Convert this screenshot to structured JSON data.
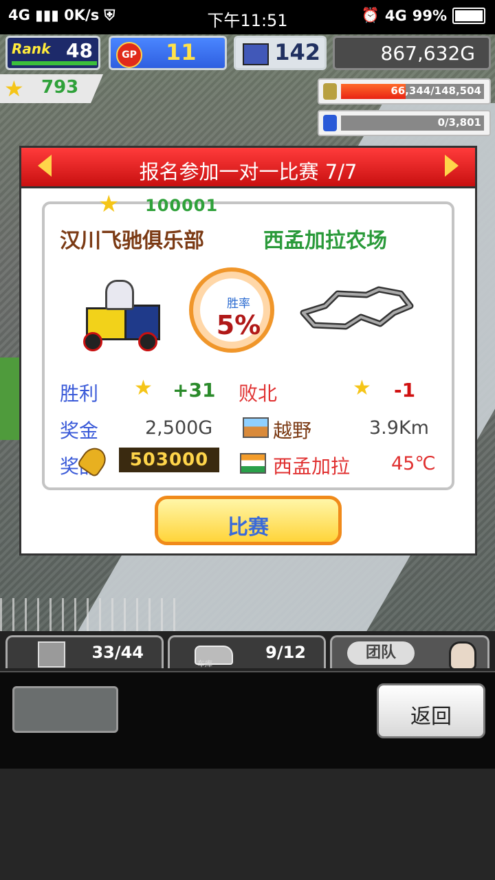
{
  "status_bar": {
    "network": "4G",
    "speed": "0K/s",
    "time": "下午11:51",
    "network_right": "4G",
    "battery": "99%"
  },
  "hud": {
    "rank_label": "Rank",
    "rank_value": "48",
    "gp_label": "GP",
    "gp_value": "11",
    "pc_value": "142",
    "money": "867,632G",
    "stars": "793",
    "resource1": "66,344/148,504",
    "resource2": "0/3,801"
  },
  "modal": {
    "title": "报名参加一对一比赛 7/7",
    "opponent_id": "100001",
    "team_left": "汉川飞驰俱乐部",
    "team_right": "西孟加拉农场",
    "win_rate_label": "胜率",
    "win_rate_value": "5%",
    "win_label": "胜利",
    "win_bonus": "+31",
    "lose_label": "败北",
    "lose_bonus": "-1",
    "prize_label": "奖金",
    "prize_value": "2,500G",
    "terrain_value": "越野",
    "distance_value": "3.9Km",
    "reward_label": "奖品",
    "reward_points": "503000",
    "region_value": "西孟加拉",
    "temperature_value": "45℃",
    "match_button": "比赛"
  },
  "bottom": {
    "tab1_value": "33/44",
    "tab2_value": "9/12",
    "tab2_caption": "车库",
    "tab3_label": "团队",
    "back_button": "返回"
  },
  "colors": {
    "header_red": "#e01818",
    "win_blue": "#3a5ad8",
    "lose_red": "#e03030",
    "button_orange": "#f08a1a"
  }
}
